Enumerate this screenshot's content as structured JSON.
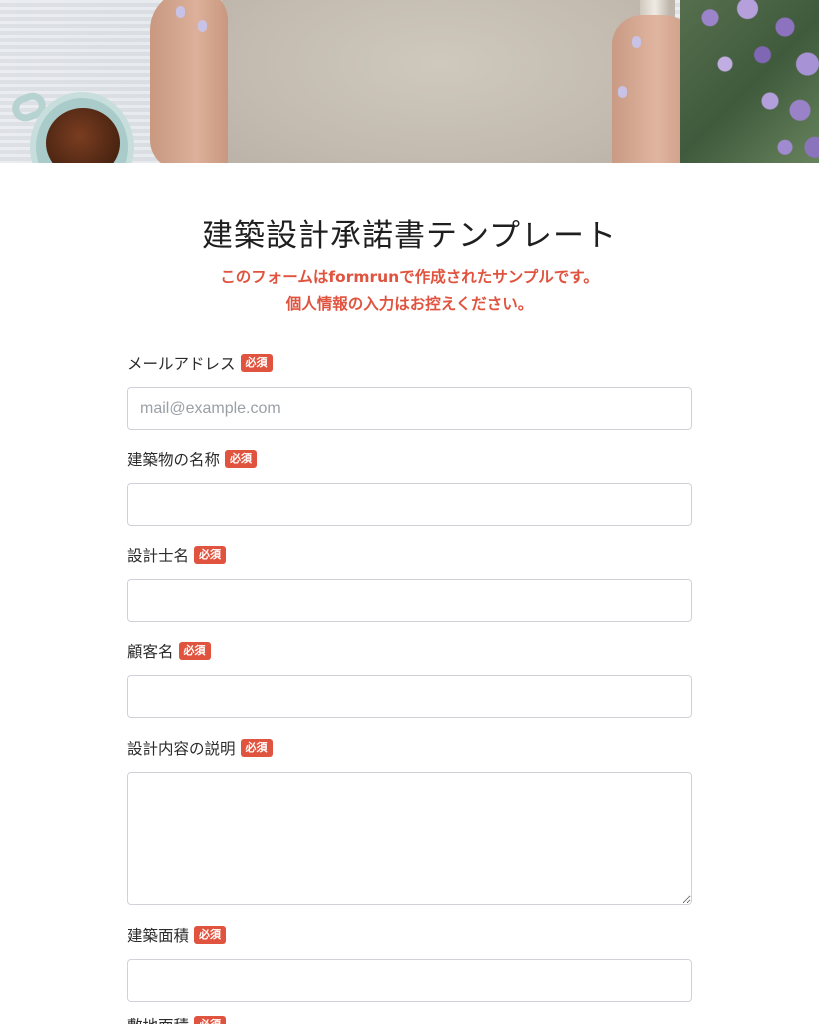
{
  "header": {
    "image_alt": "hands holding paper roll with tea and flowers"
  },
  "form": {
    "title": "建築設計承諾書テンプレート",
    "notice_line1": "このフォームはformrunで作成されたサンプルです。",
    "notice_line2": "個人情報の入力はお控えください。",
    "required_label": "必須",
    "fields": [
      {
        "label": "メールアドレス",
        "placeholder": "mail@example.com",
        "value": ""
      },
      {
        "label": "建築物の名称",
        "placeholder": "",
        "value": ""
      },
      {
        "label": "設計士名",
        "placeholder": "",
        "value": ""
      },
      {
        "label": "顧客名",
        "placeholder": "",
        "value": ""
      },
      {
        "label": "設計内容の説明",
        "placeholder": "",
        "value": ""
      },
      {
        "label": "建築面積",
        "placeholder": "",
        "value": ""
      },
      {
        "label": "敷地面積",
        "placeholder": "",
        "value": ""
      }
    ]
  },
  "colors": {
    "accent_red": "#e0533f",
    "input_border": "#cfd3d7"
  }
}
